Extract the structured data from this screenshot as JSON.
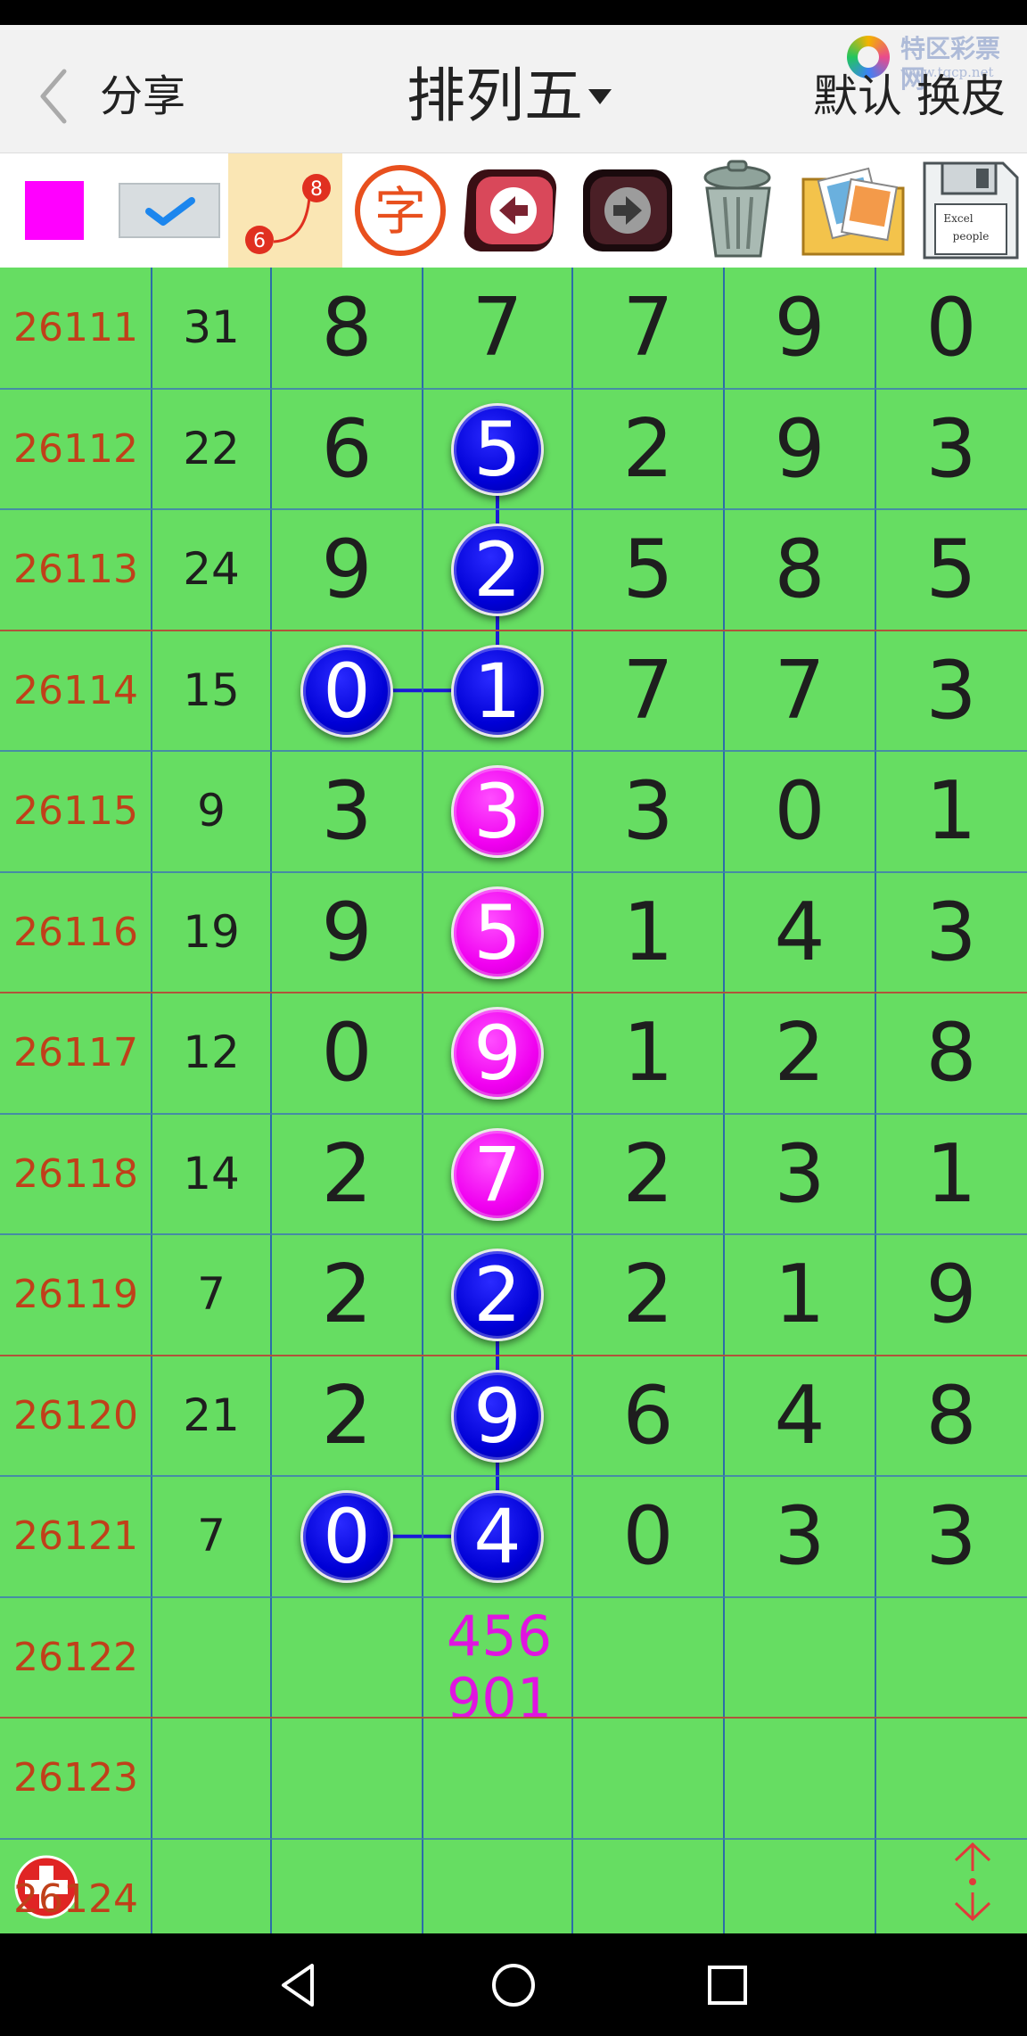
{
  "header": {
    "share_label": "分享",
    "title": "排列五",
    "default_label": "默认",
    "skin_label": "换皮",
    "watermark_name": "特区彩票网",
    "watermark_url": "www.tqcp.net"
  },
  "toolbar": {
    "color_swatch": "#ff00ff",
    "trend_badge_top": "8",
    "trend_badge_bottom": "6",
    "char_label": "字",
    "floppy_label_1": "Excel",
    "floppy_label_2": "people"
  },
  "colors": {
    "grid_bg": "#66dd62",
    "issue_text": "#c0401a",
    "ball_blue": "#0000d6",
    "ball_magenta": "#f000f0",
    "prediction": "#e014e0"
  },
  "rows": [
    {
      "issue": "26111",
      "sum": "31",
      "d": [
        "8",
        "7",
        "7",
        "9",
        "0"
      ]
    },
    {
      "issue": "26112",
      "sum": "22",
      "d": [
        "6",
        "5",
        "2",
        "9",
        "3"
      ]
    },
    {
      "issue": "26113",
      "sum": "24",
      "d": [
        "9",
        "2",
        "5",
        "8",
        "5"
      ]
    },
    {
      "issue": "26114",
      "sum": "15",
      "d": [
        "0",
        "1",
        "7",
        "7",
        "3"
      ]
    },
    {
      "issue": "26115",
      "sum": "9",
      "d": [
        "3",
        "3",
        "3",
        "0",
        "1"
      ]
    },
    {
      "issue": "26116",
      "sum": "19",
      "d": [
        "9",
        "5",
        "1",
        "4",
        "3"
      ]
    },
    {
      "issue": "26117",
      "sum": "12",
      "d": [
        "0",
        "9",
        "1",
        "2",
        "8"
      ]
    },
    {
      "issue": "26118",
      "sum": "14",
      "d": [
        "2",
        "7",
        "2",
        "3",
        "1"
      ]
    },
    {
      "issue": "26119",
      "sum": "7",
      "d": [
        "2",
        "2",
        "2",
        "1",
        "9"
      ]
    },
    {
      "issue": "26120",
      "sum": "21",
      "d": [
        "2",
        "9",
        "6",
        "4",
        "8"
      ]
    },
    {
      "issue": "26121",
      "sum": "7",
      "d": [
        "0",
        "4",
        "0",
        "3",
        "3"
      ]
    }
  ],
  "highlights": [
    {
      "row": 1,
      "col": 1,
      "color": "blue"
    },
    {
      "row": 2,
      "col": 1,
      "color": "blue"
    },
    {
      "row": 3,
      "col": 0,
      "color": "blue"
    },
    {
      "row": 3,
      "col": 1,
      "color": "blue"
    },
    {
      "row": 4,
      "col": 1,
      "color": "magenta"
    },
    {
      "row": 5,
      "col": 1,
      "color": "magenta"
    },
    {
      "row": 6,
      "col": 1,
      "color": "magenta"
    },
    {
      "row": 7,
      "col": 1,
      "color": "magenta"
    },
    {
      "row": 8,
      "col": 1,
      "color": "blue"
    },
    {
      "row": 9,
      "col": 1,
      "color": "blue"
    },
    {
      "row": 10,
      "col": 0,
      "color": "blue"
    },
    {
      "row": 10,
      "col": 1,
      "color": "blue"
    }
  ],
  "future_rows": [
    {
      "issue": "26122",
      "prediction_line1": "456",
      "prediction_line2": "901"
    },
    {
      "issue": "26123"
    },
    {
      "issue": "26124"
    }
  ],
  "nav": {
    "back_icon": "triangle-back-icon",
    "home_icon": "circle-home-icon",
    "recents_icon": "square-recents-icon"
  }
}
